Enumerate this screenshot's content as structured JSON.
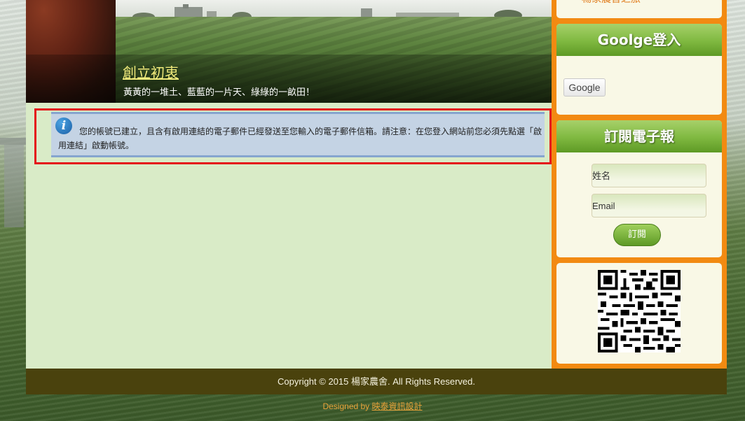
{
  "banner": {
    "title": "創立初衷",
    "subtitle": "黃黃的一堆土、藍藍的一片天、綠綠的一畝田！"
  },
  "notice": {
    "icon": "info-icon",
    "icon_glyph": "i",
    "message": "您的帳號已建立，且含有啟用連結的電子郵件已經發送至您輸入的電子郵件信箱。請注意：在您登入網站前您必須先點選「啟用連結」啟動帳號。"
  },
  "sidebar": {
    "top_link": "楊家農舍之旅",
    "google_box": {
      "title": "Goolge登入",
      "button_label": "Google"
    },
    "newsletter_box": {
      "title": "訂閱電子報",
      "name_placeholder": "姓名",
      "email_placeholder": "Email",
      "subscribe_label": "訂閱"
    }
  },
  "footer": {
    "copyright": "Copyright © 2015 楊家農舍. All Rights Reserved.",
    "designed_prefix": "Designed by ",
    "designed_link": "映泰資訊設計"
  },
  "colors": {
    "sidebar_orange": "#f28a12",
    "header_green": "#7fb840",
    "highlight_red": "#e4141b",
    "footer_brown": "#4a420d"
  }
}
